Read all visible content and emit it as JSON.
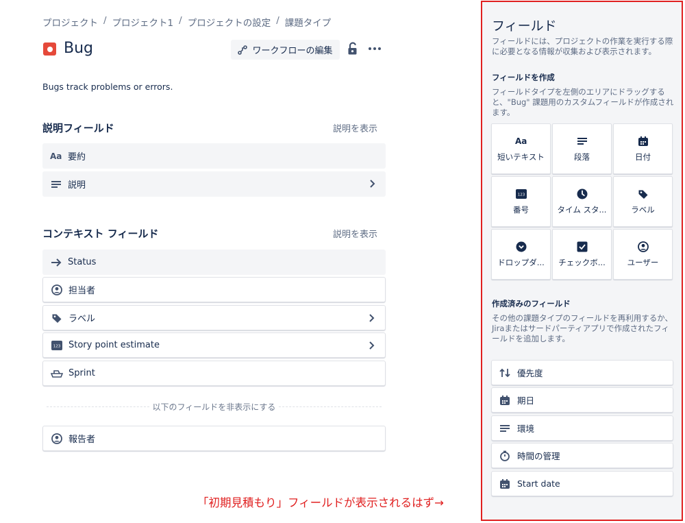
{
  "breadcrumb": [
    "プロジェクト",
    "プロジェクト1",
    "プロジェクトの設定",
    "課題タイプ"
  ],
  "breadcrumb_separator": "/",
  "issue_type": {
    "title": "Bug",
    "icon": "bug-icon",
    "color": "#e5493a",
    "description": "Bugs track problems or errors."
  },
  "toolbar": {
    "workflow_label": "ワークフローの編集"
  },
  "description_section": {
    "title": "説明フィールド",
    "show_desc": "説明を表示",
    "fields": [
      {
        "label": "要約",
        "icon": "text-aa-icon"
      },
      {
        "label": "説明",
        "icon": "paragraph-icon"
      }
    ]
  },
  "context_section": {
    "title": "コンテキスト フィールド",
    "show_desc": "説明を表示",
    "fields": [
      {
        "label": "Status",
        "icon": "arrow-right-icon"
      },
      {
        "label": "担当者",
        "icon": "user-icon"
      },
      {
        "label": "ラベル",
        "icon": "label-icon"
      },
      {
        "label": "Story point estimate",
        "icon": "number-icon"
      },
      {
        "label": "Sprint",
        "icon": "sprint-icon"
      }
    ],
    "hide_label": "以下のフィールドを非表示にする",
    "hidden_fields": [
      {
        "label": "報告者",
        "icon": "user-icon"
      }
    ]
  },
  "annotation": "「初期見積もり」フィールドが表示されるはず→",
  "panel": {
    "title": "フィールド",
    "subtitle": "フィールドには、プロジェクトの作業を実行する際に必要となる情報が収集および表示されます。",
    "create_title": "フィールドを作成",
    "create_desc": "フィールドタイプを左側のエリアにドラッグすると、\"Bug\" 課題用のカスタムフィールドが作成されます。",
    "field_types": [
      {
        "label": "短いテキスト",
        "icon": "text-aa-icon"
      },
      {
        "label": "段落",
        "icon": "paragraph-icon"
      },
      {
        "label": "日付",
        "icon": "calendar-icon"
      },
      {
        "label": "番号",
        "icon": "number-icon"
      },
      {
        "label": "タイム スタ...",
        "icon": "clock-icon"
      },
      {
        "label": "ラベル",
        "icon": "label-icon"
      },
      {
        "label": "ドロップダ...",
        "icon": "dropdown-icon"
      },
      {
        "label": "チェックボ...",
        "icon": "checkbox-icon"
      },
      {
        "label": "ユーザー",
        "icon": "user-icon"
      }
    ],
    "existing_title": "作成済みのフィールド",
    "existing_desc": "その他の課題タイプのフィールドを再利用するか、Jiraまたはサードパーティアプリで作成されたフィールドを追加します。",
    "existing_fields": [
      {
        "label": "優先度",
        "icon": "priority-icon"
      },
      {
        "label": "期日",
        "icon": "calendar-icon"
      },
      {
        "label": "環境",
        "icon": "paragraph-icon"
      },
      {
        "label": "時間の管理",
        "icon": "stopwatch-icon"
      },
      {
        "label": "Start date",
        "icon": "calendar-icon"
      }
    ]
  },
  "colors": {
    "text": "#172b4d",
    "muted": "#5e6c84",
    "panel_bg": "#f4f5f7",
    "highlight": "#e02020"
  }
}
